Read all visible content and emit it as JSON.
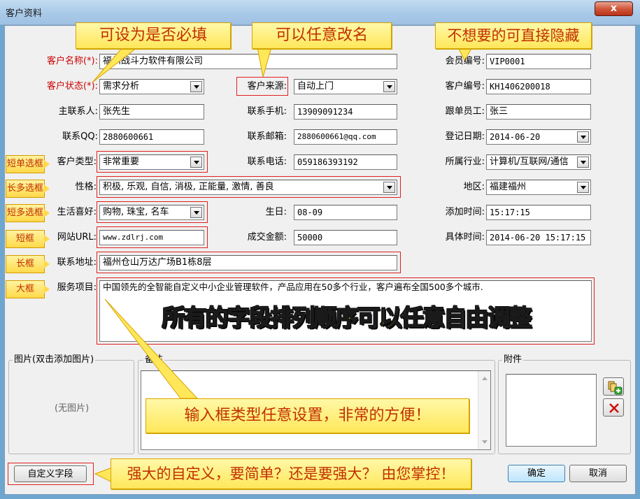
{
  "window": {
    "title": "客户资料",
    "close": "x"
  },
  "callouts": {
    "top1": "可设为是否必填",
    "top2": "可以任意改名",
    "top3": "不想要的可直接隐藏",
    "banner": "所有的字段排列顺序可以任意自由调整",
    "middle": "输入框类型任意设置，非常的方便！",
    "bottom": "强大的自定义，要简单？还是要强大？ 由您掌控！"
  },
  "tags": {
    "short_single": "短单选框",
    "long_multi": "长多选框",
    "short_multi": "短多选框",
    "short_box": "短框",
    "long_box": "长框",
    "large_box": "大框"
  },
  "fields": {
    "customer_name": {
      "label": "客户名称(*):",
      "value": "福州战斗力软件有限公司"
    },
    "customer_status": {
      "label": "客户状态(*):",
      "value": "需求分析"
    },
    "customer_source": {
      "label": "客户来源:",
      "value": "自动上门"
    },
    "member_no": {
      "label": "会员编号:",
      "value": "VIP0001"
    },
    "customer_no": {
      "label": "客户编号:",
      "value": "KH1406200018"
    },
    "main_contact": {
      "label": "主联系人:",
      "value": "张先生"
    },
    "mobile": {
      "label": "联系手机:",
      "value": "13909091234"
    },
    "staff": {
      "label": "跟单员工:",
      "value": "张三"
    },
    "qq": {
      "label": "联系QQ:",
      "value": "2880600661"
    },
    "email": {
      "label": "联系邮箱:",
      "value": "2880600661@qq.com"
    },
    "reg_date": {
      "label": "登记日期:",
      "value": "2014-06-20"
    },
    "customer_type": {
      "label": "客户类型:",
      "value": "非常重要"
    },
    "phone": {
      "label": "联系电话:",
      "value": "059186393192"
    },
    "industry": {
      "label": "所属行业:",
      "value": "计算机/互联网/通信"
    },
    "personality": {
      "label": "性格:",
      "value": "积极, 乐观, 自信, 消极, 正能量, 激情, 善良"
    },
    "region": {
      "label": "地区:",
      "value": "福建福州"
    },
    "hobby": {
      "label": "生活喜好:",
      "value": "购物, 珠宝, 名车"
    },
    "birthday": {
      "label": "生日:",
      "value": "08-09"
    },
    "add_time": {
      "label": "添加时间:",
      "value": "15:17:15"
    },
    "website": {
      "label": "网站URL:",
      "value": "www.zdlrj.com"
    },
    "deal_amount": {
      "label": "成交金额:",
      "value": "50000"
    },
    "exact_time": {
      "label": "具体时间:",
      "value": "2014-06-20 15:17:15"
    },
    "address": {
      "label": "联系地址:",
      "value": "福州仓山万达广场B1栋8层"
    },
    "service": {
      "label": "服务项目:",
      "value": "中国领先的全智能自定义中小企业管理软件，产品应用在50多个行业，客户遍布全国500多个城市."
    }
  },
  "groups": {
    "picture": "图片(双击添加图片)",
    "no_picture": "(无图片)",
    "remarks": "备注",
    "attachments": "附件"
  },
  "buttons": {
    "custom_fields": "自定义字段",
    "ok": "确定",
    "cancel": "取消"
  },
  "colors": {
    "required_label": "#cc0000",
    "callout_text": "#c03000",
    "highlight_frame": "#e02020",
    "banner_text": "#ffe600"
  },
  "icons": {
    "add_attachment": "add-attachment-icon",
    "delete_attachment": "delete-icon",
    "dropdown": "chevron-down-icon"
  }
}
